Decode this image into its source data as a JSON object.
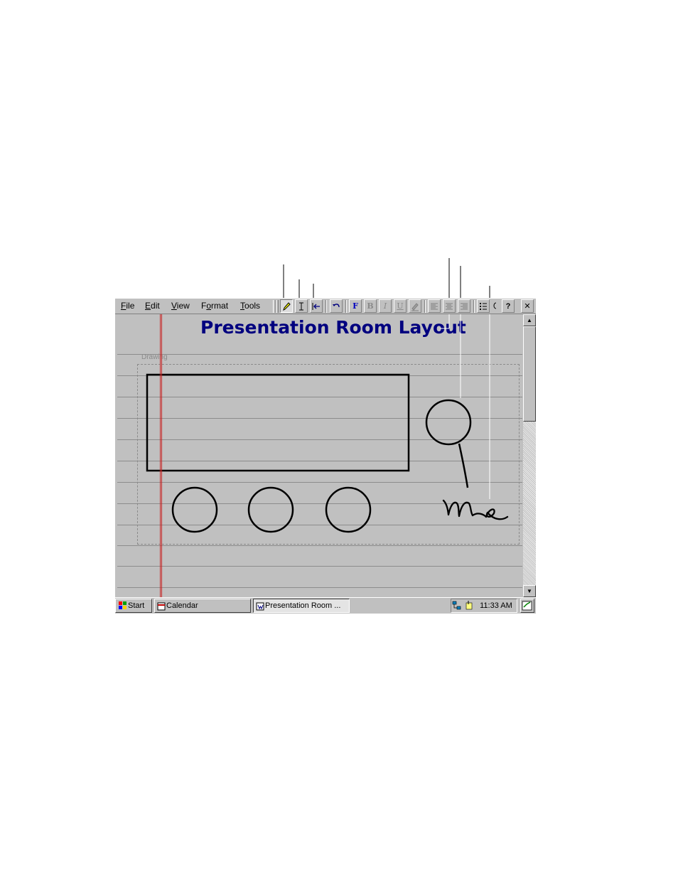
{
  "menu": {
    "file": "File",
    "edit": "Edit",
    "view": "View",
    "format": "Format",
    "tools": "Tools"
  },
  "toolbar": {
    "bold": "B",
    "italic": "I",
    "underline": "U",
    "help": "?",
    "close": "✕",
    "font_glyph": "F"
  },
  "document": {
    "title": "Presentation Room Layout",
    "drawing_label": "Drawing",
    "handwriting": "me"
  },
  "taskbar": {
    "start": "Start",
    "calendar": "Calendar",
    "active_task": "Presentation Room ...",
    "clock": "11:33 AM"
  },
  "colors": {
    "title": "#00007f",
    "margin": "#c82020",
    "chrome": "#c0c0c0"
  }
}
